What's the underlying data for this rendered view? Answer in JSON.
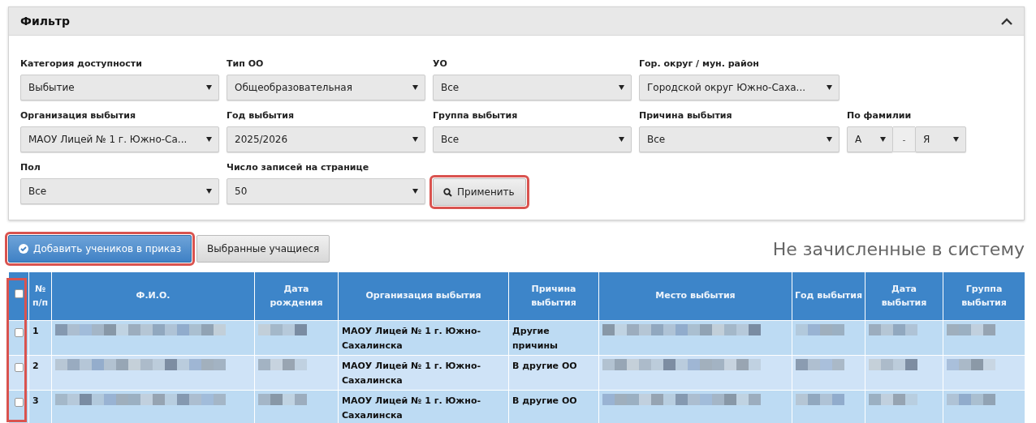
{
  "filter": {
    "title": "Фильтр",
    "expanded": true,
    "rows": [
      [
        {
          "kind": "select",
          "label": "Категория доступности",
          "value": "Выбытие"
        },
        {
          "kind": "select",
          "label": "Тип ОО",
          "value": "Общеобразовательная"
        },
        {
          "kind": "select",
          "label": "УО",
          "value": "Все"
        },
        {
          "kind": "select",
          "label": "Гор. округ / мун. район",
          "value": "Городской округ Южно-Саха..."
        }
      ],
      [
        {
          "kind": "select",
          "label": "Организация выбытия",
          "value": "МАОУ Лицей № 1 г. Южно-Са..."
        },
        {
          "kind": "select",
          "label": "Год выбытия",
          "value": "2025/2026"
        },
        {
          "kind": "select",
          "label": "Группа выбытия",
          "value": "Все"
        },
        {
          "kind": "select",
          "label": "Причина выбытия",
          "value": "Все"
        },
        {
          "kind": "range",
          "label": "По фамилии",
          "from": "А",
          "separator": "-",
          "to": "Я"
        }
      ],
      [
        {
          "kind": "select",
          "label": "Пол",
          "value": "Все"
        },
        {
          "kind": "select",
          "label": "Число записей на странице",
          "value": "50"
        },
        {
          "kind": "button",
          "label": "Применить",
          "highlighted": true
        }
      ]
    ]
  },
  "actions": [
    {
      "label": "Добавить учеников в приказ",
      "kind": "primary",
      "highlighted": true
    },
    {
      "label": "Выбранные учащиеся",
      "kind": "default",
      "highlighted": false
    }
  ],
  "section_title": "Не зачисленные в систему",
  "table": {
    "select_all_checked": false,
    "checkbox_column_highlighted": true,
    "columns": [
      "№ п/п",
      "Ф.И.О.",
      "Дата рождения",
      "Организация выбытия",
      "Причина выбытия",
      "Место выбытия",
      "Год выбытия",
      "Дата выбытия",
      "Группа выбытия"
    ],
    "rows": [
      {
        "checked": false,
        "cells": [
          {
            "kind": "text",
            "text": "1"
          },
          {
            "kind": "redacted"
          },
          {
            "kind": "redacted"
          },
          {
            "kind": "text",
            "text": "МАОУ Лицей № 1 г. Южно-Сахалинска"
          },
          {
            "kind": "text",
            "text": "Другие причины"
          },
          {
            "kind": "redacted"
          },
          {
            "kind": "redacted"
          },
          {
            "kind": "redacted"
          },
          {
            "kind": "redacted"
          }
        ]
      },
      {
        "checked": false,
        "cells": [
          {
            "kind": "text",
            "text": "2"
          },
          {
            "kind": "redacted"
          },
          {
            "kind": "redacted"
          },
          {
            "kind": "text",
            "text": "МАОУ Лицей № 1 г. Южно-Сахалинска"
          },
          {
            "kind": "text",
            "text": "В другие ОО"
          },
          {
            "kind": "redacted"
          },
          {
            "kind": "redacted"
          },
          {
            "kind": "redacted"
          },
          {
            "kind": "redacted"
          }
        ]
      },
      {
        "checked": false,
        "cells": [
          {
            "kind": "text",
            "text": "3"
          },
          {
            "kind": "redacted"
          },
          {
            "kind": "redacted"
          },
          {
            "kind": "text",
            "text": "МАОУ Лицей № 1 г. Южно-Сахалинска"
          },
          {
            "kind": "text",
            "text": "В другие ОО"
          },
          {
            "kind": "redacted"
          },
          {
            "kind": "redacted"
          },
          {
            "kind": "redacted"
          },
          {
            "kind": "redacted"
          }
        ]
      }
    ]
  }
}
